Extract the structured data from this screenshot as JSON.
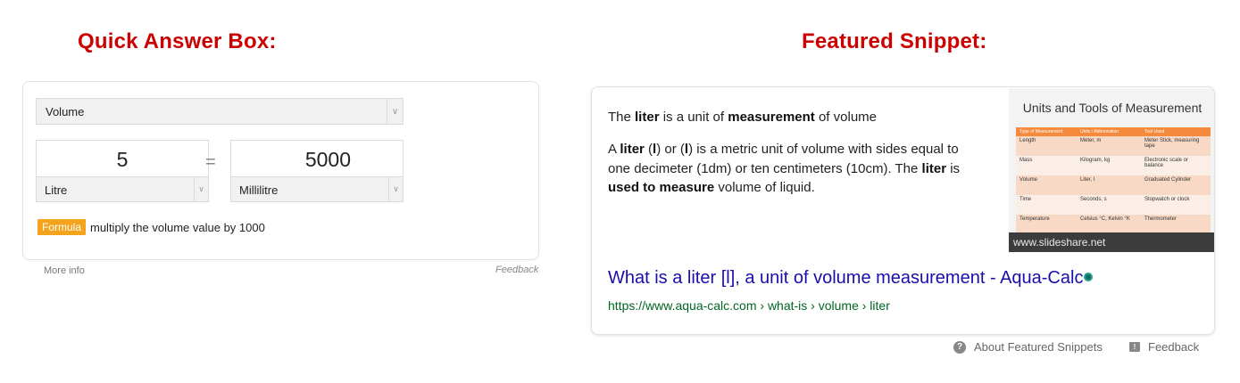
{
  "headings": {
    "left": "Quick Answer Box:",
    "right": "Featured Snippet:"
  },
  "quick_answer": {
    "category": "Volume",
    "left_value": "5",
    "left_unit": "Litre",
    "equals": "=",
    "right_value": "5000",
    "right_unit": "Millilitre",
    "formula_badge": "Formula",
    "formula_text": "multiply the volume value by 1000",
    "more_info": "More info",
    "feedback": "Feedback"
  },
  "featured_snippet": {
    "lead": [
      "The ",
      "liter",
      " is a unit of ",
      "measurement",
      " of volume"
    ],
    "body": [
      "A ",
      "liter",
      " (",
      "l",
      ") or (",
      "l",
      ") is a metric unit of volume with sides equal to one decimeter (1dm) or ten centimeters (10cm). The ",
      "liter",
      " is ",
      "used to measure",
      " volume of liquid."
    ],
    "image": {
      "title": "Units and Tools of Measurement",
      "header": [
        "Type of Measurement",
        "Units / Abbreviation",
        "Tool Used"
      ],
      "rows": [
        [
          "Length",
          "Meter, m",
          "Meter Stick, measuring tape"
        ],
        [
          "Mass",
          "Kilogram, kg",
          "Electronic scale or balance"
        ],
        [
          "Volume",
          "Liter, l",
          "Graduated Cylinder"
        ],
        [
          "Time",
          "Seconds, s",
          "Stopwatch or clock"
        ],
        [
          "Temperature",
          "Celsius °C, Kelvin °K",
          "Thermometer"
        ]
      ],
      "caption": "www.slideshare.net"
    },
    "link_title": "What is a liter [l], a unit of volume measurement - Aqua-Calc",
    "url": "https://www.aqua-calc.com › what-is › volume › liter",
    "about": "About Featured Snippets",
    "feedback": "Feedback"
  },
  "colors": {
    "heading": "#cc0000",
    "formula_badge": "#f4a31c",
    "link": "#1a0dab",
    "url": "#006621"
  }
}
